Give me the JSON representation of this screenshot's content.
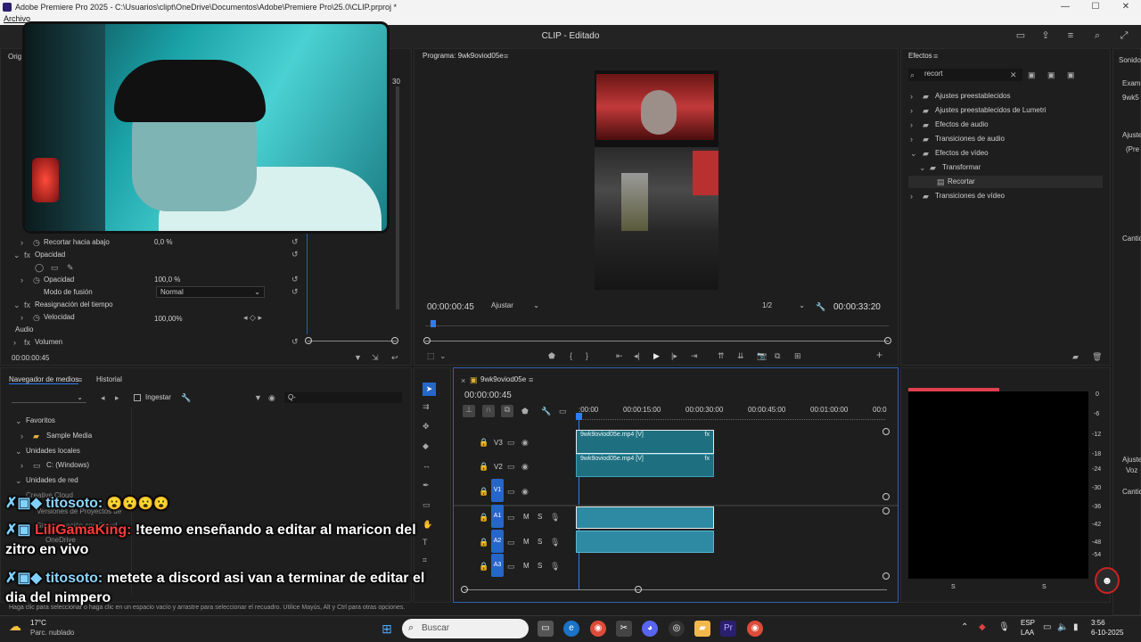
{
  "window": {
    "title": "Adobe Premiere Pro 2025 - C:\\Usuarios\\clipt\\OneDrive\\Documentos\\Adobe\\Premiere Pro\\25.0\\CLIP.prproj *",
    "menu_first": "Archivo",
    "workspace_title": "CLIP - Editado"
  },
  "effect_controls": {
    "tab_partial": "Orig",
    "value_30": "30",
    "rows": [
      {
        "label": "Recortar hacia abajo",
        "value": "0,0 %"
      },
      {
        "label": "Opacidad",
        "value": ""
      },
      {
        "label": "Opacidad",
        "value": "100,0 %"
      },
      {
        "label": "Modo de fusión",
        "value": "Normal"
      },
      {
        "label": "Reasignación del tiempo",
        "value": ""
      },
      {
        "label": "Velocidad",
        "value": "100,00%"
      },
      {
        "label": "Audio",
        "value": ""
      },
      {
        "label": "Volumen",
        "value": ""
      }
    ],
    "timecode": "00:00:00:45"
  },
  "program": {
    "title": "Programa: 9wk9oviod05e",
    "timecode": "00:00:00:45",
    "fit": "Ajustar",
    "resolution": "1/2",
    "duration": "00:00:33:20"
  },
  "effects": {
    "title": "Efectos",
    "search": "recort",
    "items": [
      {
        "label": "Ajustes preestablecidos"
      },
      {
        "label": "Ajustes preestablecidos de Lumetri"
      },
      {
        "label": "Efectos de audio"
      },
      {
        "label": "Transiciones de audio"
      },
      {
        "label": "Efectos de vídeo"
      },
      {
        "label": "Transformar"
      },
      {
        "label": "Recortar"
      },
      {
        "label": "Transiciones de vídeo"
      }
    ],
    "right_tab": "Sonido",
    "right_partial_1": "Exami",
    "right_partial_2": "9wk5",
    "right_partial_3": "Ajuste",
    "right_partial_4": "(Pre",
    "right_partial_5": "Cantid",
    "right_partial_6": "Ajuste",
    "right_partial_7": "Voz",
    "right_partial_8": "Cantid"
  },
  "media_browser": {
    "tab1": "Navegador de medios",
    "tab2": "Historial",
    "ingest": "Ingestar",
    "search_placeholder": "Q-",
    "tree": [
      {
        "label": "Favoritos"
      },
      {
        "label": "Sample Media"
      },
      {
        "label": "Unidades locales"
      },
      {
        "label": "C: (Windows)"
      },
      {
        "label": "Unidades de red"
      },
      {
        "label": "Creative Cloud"
      },
      {
        "label": "Versiones de Proyectos de"
      },
      {
        "label": "Sincronización con Cloud"
      },
      {
        "label": "OneDrive"
      }
    ]
  },
  "timeline": {
    "sequence": "9wk9oviod05e",
    "timecode": "00:00:00:45",
    "ruler": [
      ":00:00",
      "00:00:15:00",
      "00:00:30:00",
      "00:00:45:00",
      "00:01:00:00",
      "00:0"
    ],
    "tracks": {
      "v3": "V3",
      "v2": "V2",
      "v1": "V1",
      "a1": "A1",
      "a2": "A2",
      "a3": "A3",
      "m": "M",
      "s": "S"
    },
    "clip_v3": "9wk9oviod05e.mp4 [V]",
    "clip_v2": "9wk9oviod05e.mp4 [V]",
    "fx": "fx"
  },
  "audio_meter": {
    "scale": [
      "0",
      "-6",
      "-12",
      "-18",
      "-24",
      "-30",
      "-36",
      "-42",
      "-48",
      "-54"
    ],
    "s_left": "S",
    "s_right": "S"
  },
  "chat": [
    {
      "user": "titosoto:",
      "message": "",
      "user_color": "#8fd6ff"
    },
    {
      "user": "LiliGamaKing:",
      "message": "!teemo enseñando a editar al maricon del",
      "message2": "zitro en vivo",
      "user_color": "#ff3b3b"
    },
    {
      "user": "titosoto:",
      "message": "metete a discord asi van a terminar de editar el",
      "message2": "dia del nimpero",
      "user_color": "#8fd6ff"
    }
  ],
  "statusbar": "Haga clic para seleccionar o haga clic en un espacio vacío y arrastre para seleccionar el recuadro. Utilice Mayús, Alt y Ctrl para otras opciones.",
  "taskbar": {
    "weather_temp": "17°C",
    "weather_desc": "Parc. nublado",
    "search": "Buscar",
    "lang1": "ESP",
    "lang2": "LAA",
    "time": "3:56",
    "date": "6-10-2025"
  }
}
